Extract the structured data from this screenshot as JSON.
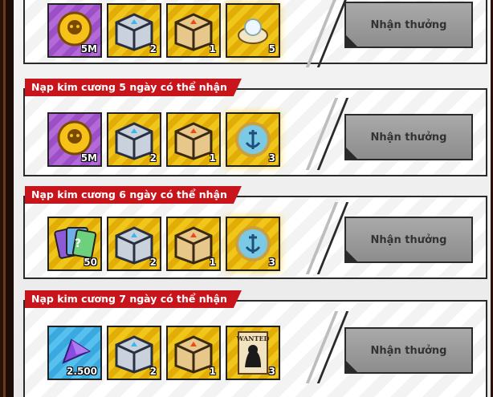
{
  "rows": [
    {
      "title": "",
      "claim_label": "Nhận thưởng",
      "items": [
        {
          "icon": "coin-skull-icon",
          "qty": "5M",
          "bg": "purple"
        },
        {
          "icon": "silver-chest-icon",
          "qty": "2",
          "bg": "gold"
        },
        {
          "icon": "gold-chest-icon",
          "qty": "1",
          "bg": "gold"
        },
        {
          "icon": "pearl-shell-icon",
          "qty": "5",
          "bg": "gold"
        }
      ]
    },
    {
      "title": "Nạp kim cương 5 ngày có thể nhận",
      "claim_label": "Nhận thưởng",
      "items": [
        {
          "icon": "coin-skull-icon",
          "qty": "5M",
          "bg": "purple"
        },
        {
          "icon": "silver-chest-icon",
          "qty": "2",
          "bg": "gold"
        },
        {
          "icon": "gold-chest-icon",
          "qty": "1",
          "bg": "gold"
        },
        {
          "icon": "anchor-medallion-icon",
          "qty": "3",
          "bg": "gold"
        }
      ]
    },
    {
      "title": "Nạp kim cương 6 ngày có thể nhận",
      "claim_label": "Nhận thưởng",
      "items": [
        {
          "icon": "card-pack-icon",
          "qty": "50",
          "bg": "gold"
        },
        {
          "icon": "silver-chest-icon",
          "qty": "2",
          "bg": "gold"
        },
        {
          "icon": "gold-chest-icon",
          "qty": "1",
          "bg": "gold"
        },
        {
          "icon": "anchor-medallion-icon",
          "qty": "3",
          "bg": "gold"
        }
      ]
    },
    {
      "title": "Nạp kim cương 7 ngày có thể nhận",
      "claim_label": "Nhận thưởng",
      "items": [
        {
          "icon": "diamond-gem-icon",
          "qty": "2.500",
          "bg": "blue"
        },
        {
          "icon": "silver-chest-icon",
          "qty": "2",
          "bg": "gold"
        },
        {
          "icon": "gold-chest-icon",
          "qty": "1",
          "bg": "gold"
        },
        {
          "icon": "wanted-poster-icon",
          "qty": "3",
          "bg": "gold"
        }
      ],
      "poster_text": "WANTED"
    }
  ]
}
